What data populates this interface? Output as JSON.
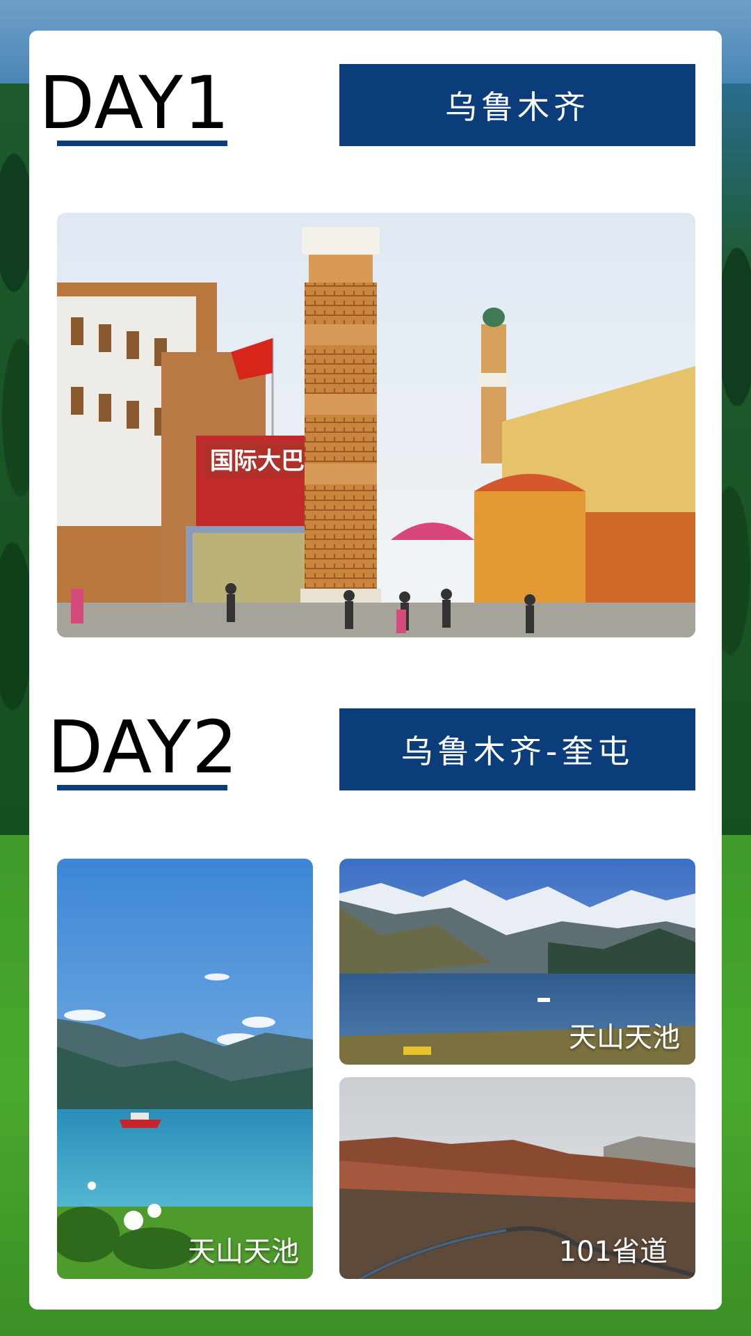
{
  "day1": {
    "label": "DAY1",
    "city": "乌鲁木齐",
    "photo_icon": "bazaar-tower-photo"
  },
  "day2": {
    "label": "DAY2",
    "route": "乌鲁木齐-奎屯",
    "photos": [
      {
        "caption": "天山天池",
        "icon": "lake-boat-photo"
      },
      {
        "caption": "天山天池",
        "icon": "mountain-lake-photo"
      },
      {
        "caption": "101省道",
        "icon": "canyon-road-photo"
      }
    ]
  },
  "colors": {
    "accent": "#0b3d7a",
    "card": "#ffffff"
  }
}
